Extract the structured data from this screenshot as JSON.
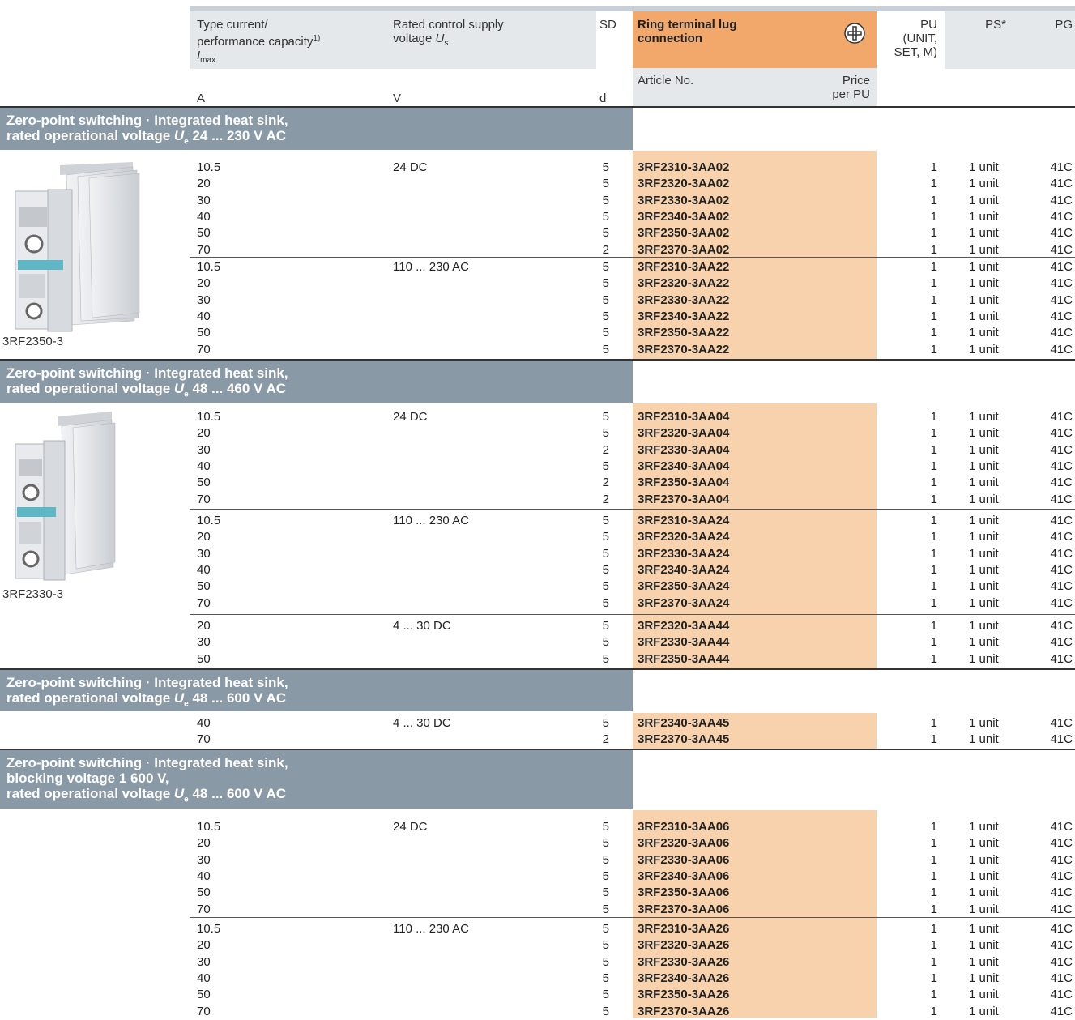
{
  "header": {
    "col_current": "Type current/",
    "col_current2": "performance capacity",
    "col_current_sup": "1)",
    "col_current_sym": "I",
    "col_current_sub": "max",
    "col_voltage": "Rated control supply",
    "col_voltage2": "voltage ",
    "col_voltage_sym": "U",
    "col_voltage_sub": "s",
    "col_sd": "SD",
    "col_ring": "Ring terminal lug",
    "col_ring2": "connection",
    "col_pu": "PU",
    "col_pu2": "(UNIT,",
    "col_pu3": "SET, M)",
    "col_ps": "PS*",
    "col_pg": "PG",
    "col_article": "Article No.",
    "col_price": "Price",
    "col_price2": "per PU",
    "unit_a": "A",
    "unit_v": "V",
    "unit_d": "d",
    "ring_icon": "screw-terminal-icon"
  },
  "sections": [
    {
      "line1": "Zero-point switching · Integrated heat sink,",
      "line2a": "rated operational voltage ",
      "sym": "U",
      "sub": "e",
      "line2b": " 24 ... 230 V AC"
    },
    {
      "line1": "Zero-point switching · Integrated heat sink,",
      "line2a": "rated operational voltage ",
      "sym": "U",
      "sub": "e",
      "line2b": " 48 ... 460 V AC"
    },
    {
      "line1": "Zero-point switching · Integrated heat sink,",
      "line2a": "rated operational voltage ",
      "sym": "U",
      "sub": "e",
      "line2b": " 48 ... 600 V AC"
    },
    {
      "line1": "Zero-point switching · Integrated heat sink,",
      "line1b": "blocking voltage 1 600 V,",
      "line2a": "rated operational voltage ",
      "sym": "U",
      "sub": "e",
      "line2b": " 48 ... 600 V AC"
    }
  ],
  "captions": [
    "3RF2350-3",
    "3RF2330-3"
  ],
  "groups": [
    {
      "voltage": "24 DC",
      "rows": [
        {
          "a": "10.5",
          "sd": "5",
          "art": "3RF2310-3AA02",
          "pu": "1",
          "ps": "1 unit",
          "pg": "41C"
        },
        {
          "a": "20",
          "sd": "5",
          "art": "3RF2320-3AA02",
          "pu": "1",
          "ps": "1 unit",
          "pg": "41C"
        },
        {
          "a": "30",
          "sd": "5",
          "art": "3RF2330-3AA02",
          "pu": "1",
          "ps": "1 unit",
          "pg": "41C"
        },
        {
          "a": "40",
          "sd": "5",
          "art": "3RF2340-3AA02",
          "pu": "1",
          "ps": "1 unit",
          "pg": "41C"
        },
        {
          "a": "50",
          "sd": "5",
          "art": "3RF2350-3AA02",
          "pu": "1",
          "ps": "1 unit",
          "pg": "41C"
        },
        {
          "a": "70",
          "sd": "2",
          "art": "3RF2370-3AA02",
          "pu": "1",
          "ps": "1 unit",
          "pg": "41C"
        }
      ]
    },
    {
      "voltage": "110 ... 230 AC",
      "rows": [
        {
          "a": "10.5",
          "sd": "5",
          "art": "3RF2310-3AA22",
          "pu": "1",
          "ps": "1 unit",
          "pg": "41C"
        },
        {
          "a": "20",
          "sd": "5",
          "art": "3RF2320-3AA22",
          "pu": "1",
          "ps": "1 unit",
          "pg": "41C"
        },
        {
          "a": "30",
          "sd": "5",
          "art": "3RF2330-3AA22",
          "pu": "1",
          "ps": "1 unit",
          "pg": "41C"
        },
        {
          "a": "40",
          "sd": "5",
          "art": "3RF2340-3AA22",
          "pu": "1",
          "ps": "1 unit",
          "pg": "41C"
        },
        {
          "a": "50",
          "sd": "5",
          "art": "3RF2350-3AA22",
          "pu": "1",
          "ps": "1 unit",
          "pg": "41C"
        },
        {
          "a": "70",
          "sd": "5",
          "art": "3RF2370-3AA22",
          "pu": "1",
          "ps": "1 unit",
          "pg": "41C"
        }
      ]
    },
    {
      "voltage": "24 DC",
      "rows": [
        {
          "a": "10.5",
          "sd": "5",
          "art": "3RF2310-3AA04",
          "pu": "1",
          "ps": "1 unit",
          "pg": "41C"
        },
        {
          "a": "20",
          "sd": "5",
          "art": "3RF2320-3AA04",
          "pu": "1",
          "ps": "1 unit",
          "pg": "41C"
        },
        {
          "a": "30",
          "sd": "2",
          "art": "3RF2330-3AA04",
          "pu": "1",
          "ps": "1 unit",
          "pg": "41C"
        },
        {
          "a": "40",
          "sd": "5",
          "art": "3RF2340-3AA04",
          "pu": "1",
          "ps": "1 unit",
          "pg": "41C"
        },
        {
          "a": "50",
          "sd": "2",
          "art": "3RF2350-3AA04",
          "pu": "1",
          "ps": "1 unit",
          "pg": "41C"
        },
        {
          "a": "70",
          "sd": "2",
          "art": "3RF2370-3AA04",
          "pu": "1",
          "ps": "1 unit",
          "pg": "41C"
        }
      ]
    },
    {
      "voltage": "110 ... 230 AC",
      "rows": [
        {
          "a": "10.5",
          "sd": "5",
          "art": "3RF2310-3AA24",
          "pu": "1",
          "ps": "1 unit",
          "pg": "41C"
        },
        {
          "a": "20",
          "sd": "5",
          "art": "3RF2320-3AA24",
          "pu": "1",
          "ps": "1 unit",
          "pg": "41C"
        },
        {
          "a": "30",
          "sd": "5",
          "art": "3RF2330-3AA24",
          "pu": "1",
          "ps": "1 unit",
          "pg": "41C"
        },
        {
          "a": "40",
          "sd": "5",
          "art": "3RF2340-3AA24",
          "pu": "1",
          "ps": "1 unit",
          "pg": "41C"
        },
        {
          "a": "50",
          "sd": "5",
          "art": "3RF2350-3AA24",
          "pu": "1",
          "ps": "1 unit",
          "pg": "41C"
        },
        {
          "a": "70",
          "sd": "5",
          "art": "3RF2370-3AA24",
          "pu": "1",
          "ps": "1 unit",
          "pg": "41C"
        }
      ]
    },
    {
      "voltage": "4 ... 30 DC",
      "rows": [
        {
          "a": "20",
          "sd": "5",
          "art": "3RF2320-3AA44",
          "pu": "1",
          "ps": "1 unit",
          "pg": "41C"
        },
        {
          "a": "30",
          "sd": "5",
          "art": "3RF2330-3AA44",
          "pu": "1",
          "ps": "1 unit",
          "pg": "41C"
        },
        {
          "a": "50",
          "sd": "5",
          "art": "3RF2350-3AA44",
          "pu": "1",
          "ps": "1 unit",
          "pg": "41C"
        }
      ]
    },
    {
      "voltage": "4 ... 30 DC",
      "rows": [
        {
          "a": "40",
          "sd": "5",
          "art": "3RF2340-3AA45",
          "pu": "1",
          "ps": "1 unit",
          "pg": "41C"
        },
        {
          "a": "70",
          "sd": "2",
          "art": "3RF2370-3AA45",
          "pu": "1",
          "ps": "1 unit",
          "pg": "41C"
        }
      ]
    },
    {
      "voltage": "24 DC",
      "rows": [
        {
          "a": "10.5",
          "sd": "5",
          "art": "3RF2310-3AA06",
          "pu": "1",
          "ps": "1 unit",
          "pg": "41C"
        },
        {
          "a": "20",
          "sd": "5",
          "art": "3RF2320-3AA06",
          "pu": "1",
          "ps": "1 unit",
          "pg": "41C"
        },
        {
          "a": "30",
          "sd": "5",
          "art": "3RF2330-3AA06",
          "pu": "1",
          "ps": "1 unit",
          "pg": "41C"
        },
        {
          "a": "40",
          "sd": "5",
          "art": "3RF2340-3AA06",
          "pu": "1",
          "ps": "1 unit",
          "pg": "41C"
        },
        {
          "a": "50",
          "sd": "5",
          "art": "3RF2350-3AA06",
          "pu": "1",
          "ps": "1 unit",
          "pg": "41C"
        },
        {
          "a": "70",
          "sd": "5",
          "art": "3RF2370-3AA06",
          "pu": "1",
          "ps": "1 unit",
          "pg": "41C"
        }
      ]
    },
    {
      "voltage": "110 ... 230 AC",
      "rows": [
        {
          "a": "10.5",
          "sd": "5",
          "art": "3RF2310-3AA26",
          "pu": "1",
          "ps": "1 unit",
          "pg": "41C"
        },
        {
          "a": "20",
          "sd": "5",
          "art": "3RF2320-3AA26",
          "pu": "1",
          "ps": "1 unit",
          "pg": "41C"
        },
        {
          "a": "30",
          "sd": "5",
          "art": "3RF2330-3AA26",
          "pu": "1",
          "ps": "1 unit",
          "pg": "41C"
        },
        {
          "a": "40",
          "sd": "5",
          "art": "3RF2340-3AA26",
          "pu": "1",
          "ps": "1 unit",
          "pg": "41C"
        },
        {
          "a": "50",
          "sd": "5",
          "art": "3RF2350-3AA26",
          "pu": "1",
          "ps": "1 unit",
          "pg": "41C"
        },
        {
          "a": "70",
          "sd": "5",
          "art": "3RF2370-3AA26",
          "pu": "1",
          "ps": "1 unit",
          "pg": "41C"
        }
      ]
    }
  ]
}
